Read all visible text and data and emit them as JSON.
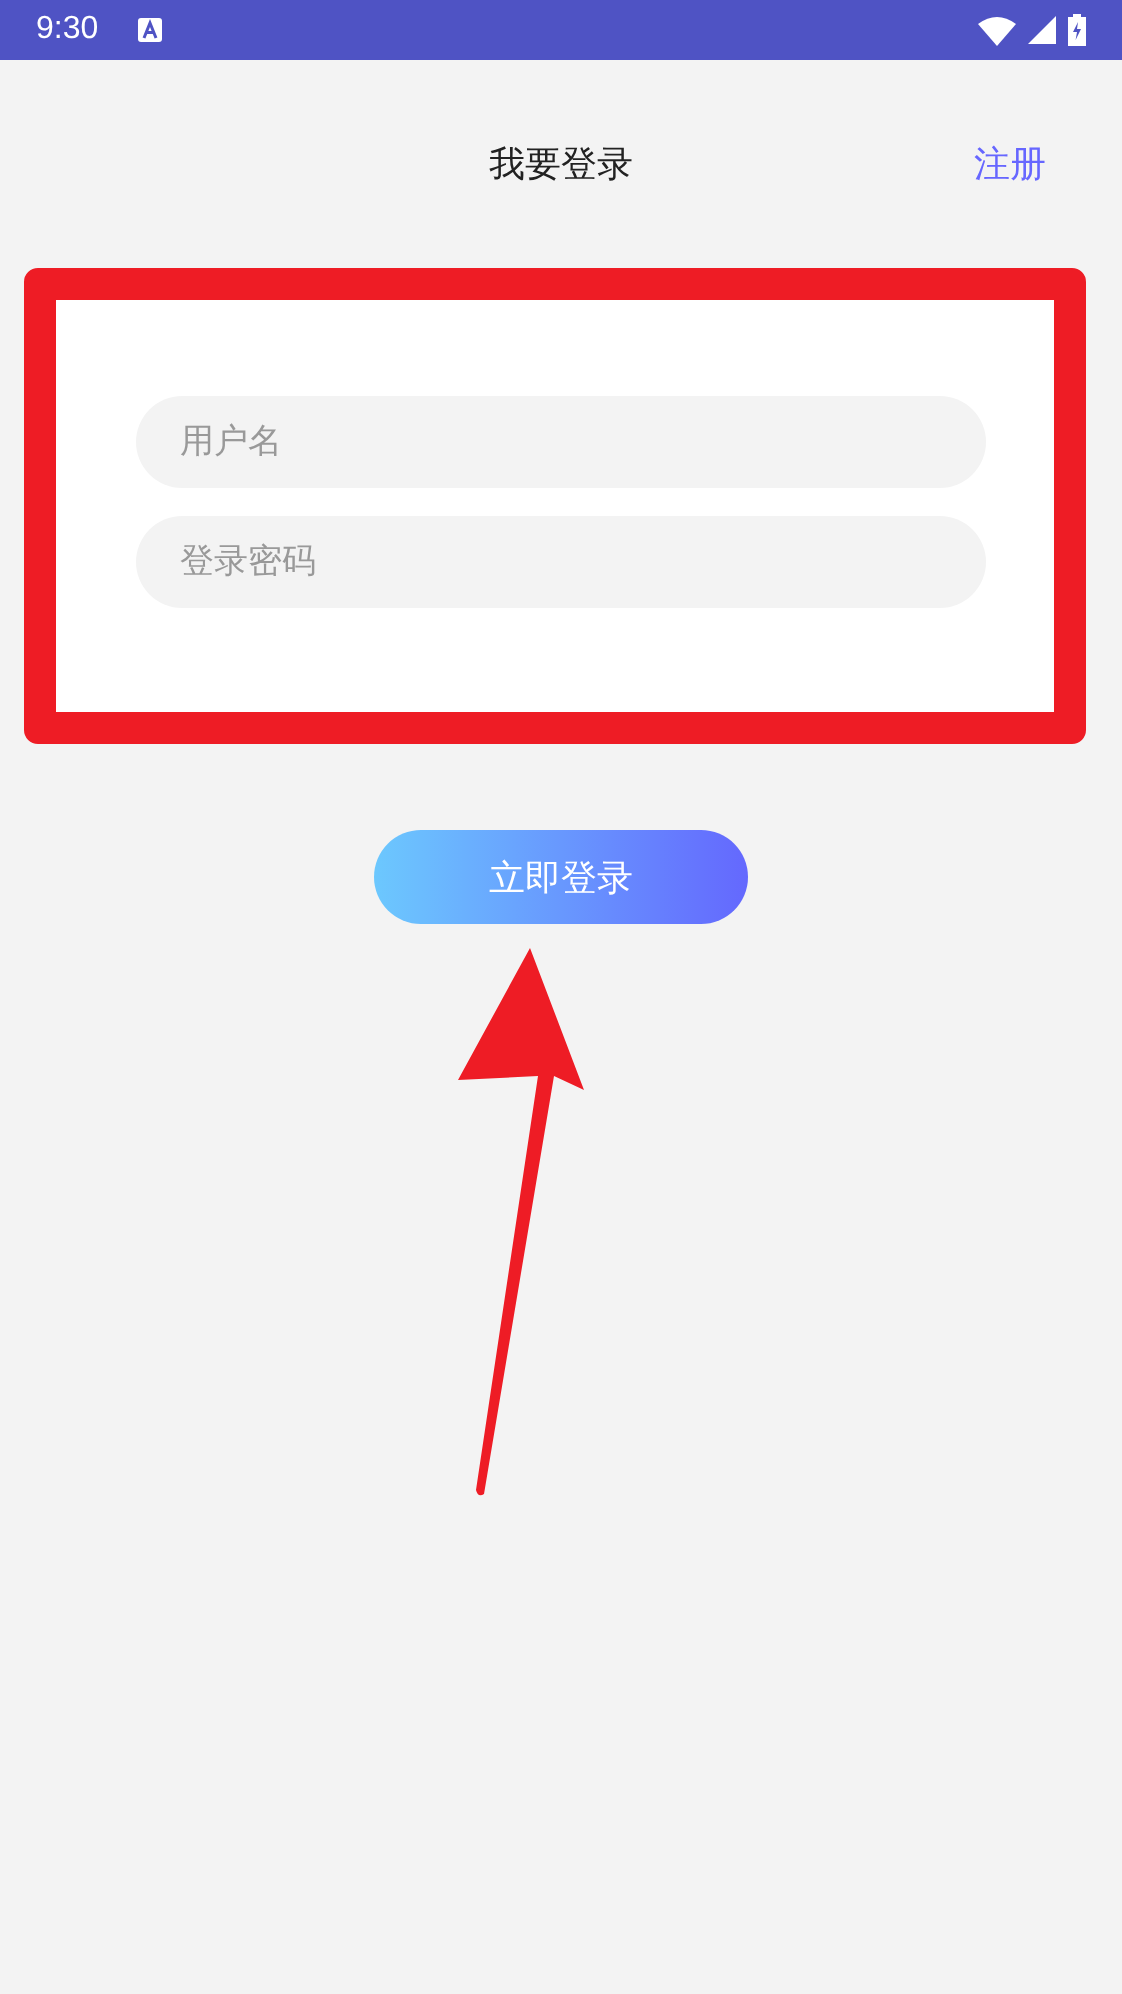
{
  "status_bar": {
    "time": "9:30"
  },
  "header": {
    "title": "我要登录",
    "action": "注册"
  },
  "form": {
    "fields": [
      {
        "placeholder": "用户名"
      },
      {
        "placeholder": "登录密码"
      }
    ]
  },
  "login_button": "立即登录"
}
